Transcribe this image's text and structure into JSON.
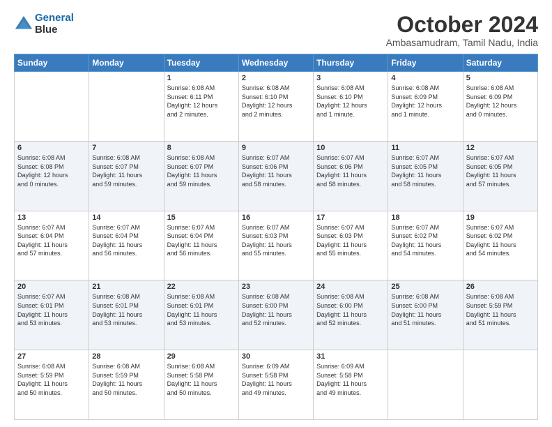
{
  "header": {
    "logo_line1": "General",
    "logo_line2": "Blue",
    "title": "October 2024",
    "subtitle": "Ambasamudram, Tamil Nadu, India"
  },
  "calendar": {
    "days_of_week": [
      "Sunday",
      "Monday",
      "Tuesday",
      "Wednesday",
      "Thursday",
      "Friday",
      "Saturday"
    ],
    "weeks": [
      [
        {
          "day": "",
          "info": ""
        },
        {
          "day": "",
          "info": ""
        },
        {
          "day": "1",
          "info": "Sunrise: 6:08 AM\nSunset: 6:11 PM\nDaylight: 12 hours\nand 2 minutes."
        },
        {
          "day": "2",
          "info": "Sunrise: 6:08 AM\nSunset: 6:10 PM\nDaylight: 12 hours\nand 2 minutes."
        },
        {
          "day": "3",
          "info": "Sunrise: 6:08 AM\nSunset: 6:10 PM\nDaylight: 12 hours\nand 1 minute."
        },
        {
          "day": "4",
          "info": "Sunrise: 6:08 AM\nSunset: 6:09 PM\nDaylight: 12 hours\nand 1 minute."
        },
        {
          "day": "5",
          "info": "Sunrise: 6:08 AM\nSunset: 6:09 PM\nDaylight: 12 hours\nand 0 minutes."
        }
      ],
      [
        {
          "day": "6",
          "info": "Sunrise: 6:08 AM\nSunset: 6:08 PM\nDaylight: 12 hours\nand 0 minutes."
        },
        {
          "day": "7",
          "info": "Sunrise: 6:08 AM\nSunset: 6:07 PM\nDaylight: 11 hours\nand 59 minutes."
        },
        {
          "day": "8",
          "info": "Sunrise: 6:08 AM\nSunset: 6:07 PM\nDaylight: 11 hours\nand 59 minutes."
        },
        {
          "day": "9",
          "info": "Sunrise: 6:07 AM\nSunset: 6:06 PM\nDaylight: 11 hours\nand 58 minutes."
        },
        {
          "day": "10",
          "info": "Sunrise: 6:07 AM\nSunset: 6:06 PM\nDaylight: 11 hours\nand 58 minutes."
        },
        {
          "day": "11",
          "info": "Sunrise: 6:07 AM\nSunset: 6:05 PM\nDaylight: 11 hours\nand 58 minutes."
        },
        {
          "day": "12",
          "info": "Sunrise: 6:07 AM\nSunset: 6:05 PM\nDaylight: 11 hours\nand 57 minutes."
        }
      ],
      [
        {
          "day": "13",
          "info": "Sunrise: 6:07 AM\nSunset: 6:04 PM\nDaylight: 11 hours\nand 57 minutes."
        },
        {
          "day": "14",
          "info": "Sunrise: 6:07 AM\nSunset: 6:04 PM\nDaylight: 11 hours\nand 56 minutes."
        },
        {
          "day": "15",
          "info": "Sunrise: 6:07 AM\nSunset: 6:04 PM\nDaylight: 11 hours\nand 56 minutes."
        },
        {
          "day": "16",
          "info": "Sunrise: 6:07 AM\nSunset: 6:03 PM\nDaylight: 11 hours\nand 55 minutes."
        },
        {
          "day": "17",
          "info": "Sunrise: 6:07 AM\nSunset: 6:03 PM\nDaylight: 11 hours\nand 55 minutes."
        },
        {
          "day": "18",
          "info": "Sunrise: 6:07 AM\nSunset: 6:02 PM\nDaylight: 11 hours\nand 54 minutes."
        },
        {
          "day": "19",
          "info": "Sunrise: 6:07 AM\nSunset: 6:02 PM\nDaylight: 11 hours\nand 54 minutes."
        }
      ],
      [
        {
          "day": "20",
          "info": "Sunrise: 6:07 AM\nSunset: 6:01 PM\nDaylight: 11 hours\nand 53 minutes."
        },
        {
          "day": "21",
          "info": "Sunrise: 6:08 AM\nSunset: 6:01 PM\nDaylight: 11 hours\nand 53 minutes."
        },
        {
          "day": "22",
          "info": "Sunrise: 6:08 AM\nSunset: 6:01 PM\nDaylight: 11 hours\nand 53 minutes."
        },
        {
          "day": "23",
          "info": "Sunrise: 6:08 AM\nSunset: 6:00 PM\nDaylight: 11 hours\nand 52 minutes."
        },
        {
          "day": "24",
          "info": "Sunrise: 6:08 AM\nSunset: 6:00 PM\nDaylight: 11 hours\nand 52 minutes."
        },
        {
          "day": "25",
          "info": "Sunrise: 6:08 AM\nSunset: 6:00 PM\nDaylight: 11 hours\nand 51 minutes."
        },
        {
          "day": "26",
          "info": "Sunrise: 6:08 AM\nSunset: 5:59 PM\nDaylight: 11 hours\nand 51 minutes."
        }
      ],
      [
        {
          "day": "27",
          "info": "Sunrise: 6:08 AM\nSunset: 5:59 PM\nDaylight: 11 hours\nand 50 minutes."
        },
        {
          "day": "28",
          "info": "Sunrise: 6:08 AM\nSunset: 5:59 PM\nDaylight: 11 hours\nand 50 minutes."
        },
        {
          "day": "29",
          "info": "Sunrise: 6:08 AM\nSunset: 5:58 PM\nDaylight: 11 hours\nand 50 minutes."
        },
        {
          "day": "30",
          "info": "Sunrise: 6:09 AM\nSunset: 5:58 PM\nDaylight: 11 hours\nand 49 minutes."
        },
        {
          "day": "31",
          "info": "Sunrise: 6:09 AM\nSunset: 5:58 PM\nDaylight: 11 hours\nand 49 minutes."
        },
        {
          "day": "",
          "info": ""
        },
        {
          "day": "",
          "info": ""
        }
      ]
    ]
  }
}
